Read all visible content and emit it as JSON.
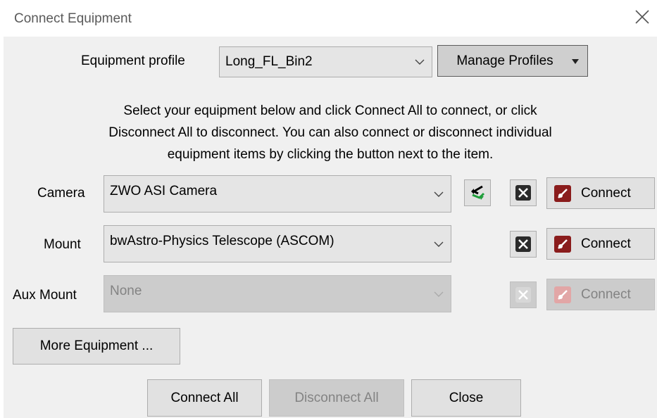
{
  "window": {
    "title": "Connect Equipment"
  },
  "profile": {
    "label": "Equipment profile",
    "value": "Long_FL_Bin2",
    "manage_label": "Manage Profiles"
  },
  "instructions": {
    "line1": "Select your equipment below and click Connect All to connect, or click",
    "line2": "Disconnect All to disconnect. You can also connect or disconnect individual",
    "line3": "equipment items by clicking the button next to the item."
  },
  "rows": {
    "camera": {
      "label": "Camera",
      "value": "ZWO ASI Camera",
      "connect_label": "Connect"
    },
    "mount": {
      "label": "Mount",
      "value": "bwAstro-Physics Telescope (ASCOM)",
      "connect_label": "Connect"
    },
    "aux_mount": {
      "label": "Aux Mount",
      "value": "None",
      "connect_label": "Connect"
    }
  },
  "buttons": {
    "more_equipment": "More Equipment ...",
    "connect_all": "Connect All",
    "disconnect_all": "Disconnect All",
    "close": "Close"
  },
  "colors": {
    "dialog_bg": "#f0f0f0",
    "title_text": "#5a5a5a",
    "plug_red": "#8a1c1c",
    "refresh_green": "#1f9e3a"
  }
}
